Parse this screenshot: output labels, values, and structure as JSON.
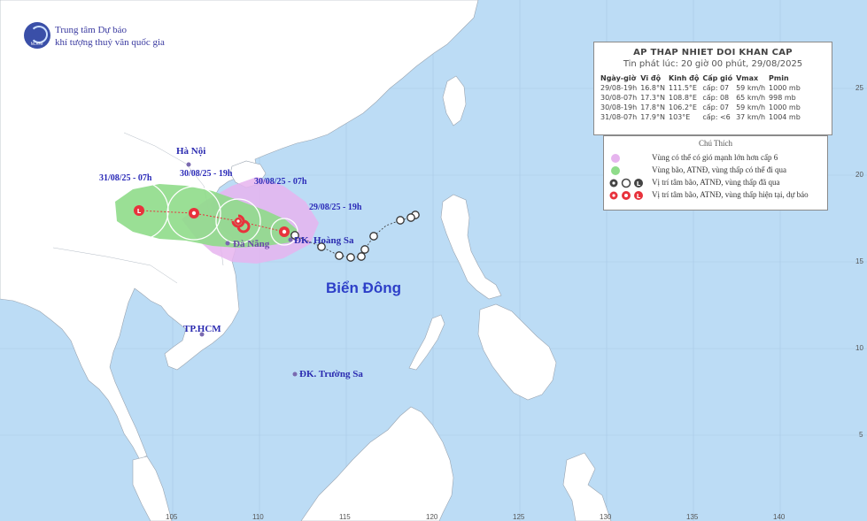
{
  "agency": {
    "line1": "Trung tâm Dự báo",
    "line2": "khí tượng thuỷ văn quốc gia",
    "logo_text": "NCHMF"
  },
  "places": {
    "hanoi": "Hà Nội",
    "danang": "Đà Nẵng",
    "hoangsa": "ĐK. Hoàng Sa",
    "hcm": "TP.HCM",
    "truongsa": "ĐK. Trường Sa",
    "sea": "Biển Đông"
  },
  "track_labels": {
    "t1": "31/08/25 - 07h",
    "t2": "30/08/25 - 19h",
    "t3": "30/08/25 - 07h",
    "t4": "29/08/25 - 19h"
  },
  "latitude_labels": [
    "25",
    "20",
    "15",
    "10",
    "5"
  ],
  "longitude_labels": [
    "105",
    "110",
    "115",
    "120",
    "125",
    "130",
    "135",
    "140"
  ],
  "bulletin": {
    "title": "AP THAP NHIET DOI KHAN CAP",
    "issued": "Tin phát lúc: 20 giờ 00 phút, 29/08/2025",
    "headers": [
      "Ngày-giờ",
      "Vĩ độ",
      "Kinh độ",
      "Cấp gió",
      "Vmax",
      "Pmin"
    ],
    "rows": [
      [
        "29/08-19h",
        "16.8°N",
        "111.5°E",
        "cấp: 07",
        "59 km/h",
        "1000 mb"
      ],
      [
        "30/08-07h",
        "17.3°N",
        "108.8°E",
        "cấp: 08",
        "65 km/h",
        "998 mb"
      ],
      [
        "30/08-19h",
        "17.8°N",
        "106.2°E",
        "cấp: 07",
        "59 km/h",
        "1000 mb"
      ],
      [
        "31/08-07h",
        "17.9°N",
        "103°E",
        "cấp: <6",
        "37 km/h",
        "1004 mb"
      ]
    ]
  },
  "legend": {
    "title": "Chú Thích",
    "items": [
      "Vùng có thể có gió mạnh lớn hơn cấp 6",
      "Vùng bão, ATNĐ, vùng thấp có thể đi qua",
      "Vị trí tâm bão, ATNĐ, vùng thấp đã qua",
      "Vị trí tâm bão, ATNĐ, vùng thấp hiện tại, dự báo"
    ]
  },
  "colors": {
    "sea": "#bcdcf5",
    "land": "#ffffff",
    "strong_wind_zone": "#e6b4ee",
    "storm_zone": "#8fdc8a",
    "forecast_marker": "#e8323c",
    "past_marker": "#444444"
  }
}
